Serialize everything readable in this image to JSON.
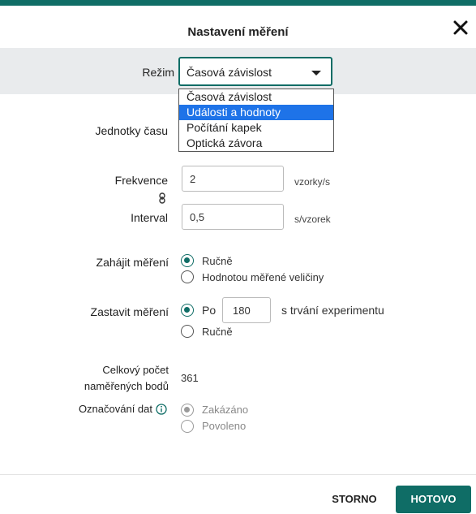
{
  "dialog": {
    "title": "Nastavení měření"
  },
  "mode": {
    "label": "Režim",
    "selected": "Časová závislost",
    "options": [
      "Časová závislost",
      "Události a hodnoty",
      "Počítání kapek",
      "Optická závora"
    ],
    "highlighted_index": 1
  },
  "time_units": {
    "label": "Jednotky času"
  },
  "frequency": {
    "label": "Frekvence",
    "value": "2",
    "unit": "vzorky/s"
  },
  "interval": {
    "label": "Interval",
    "value": "0,5",
    "unit": "s/vzorek"
  },
  "start": {
    "label": "Zahájit měření",
    "options": [
      "Ručně",
      "Hodnotou měřené veličiny"
    ],
    "selected_index": 0
  },
  "stop": {
    "label": "Zastavit měření",
    "po_label": "Po",
    "po_value": "180",
    "po_suffix": "s trvání experimentu",
    "manual_label": "Ručně",
    "selected_index": 0
  },
  "total_points": {
    "label_line1": "Celkový počet",
    "label_line2": "naměřených bodů",
    "value": "361"
  },
  "data_marking": {
    "label": "Označování dat",
    "options": [
      "Zakázáno",
      "Povoleno"
    ],
    "selected_index": 0,
    "disabled": true
  },
  "footer": {
    "cancel_label": "STORNO",
    "done_label": "HOTOVO"
  },
  "colors": {
    "accent": "#0f6d66",
    "highlight": "#1e73e8",
    "row_bg": "#e9ebed"
  }
}
